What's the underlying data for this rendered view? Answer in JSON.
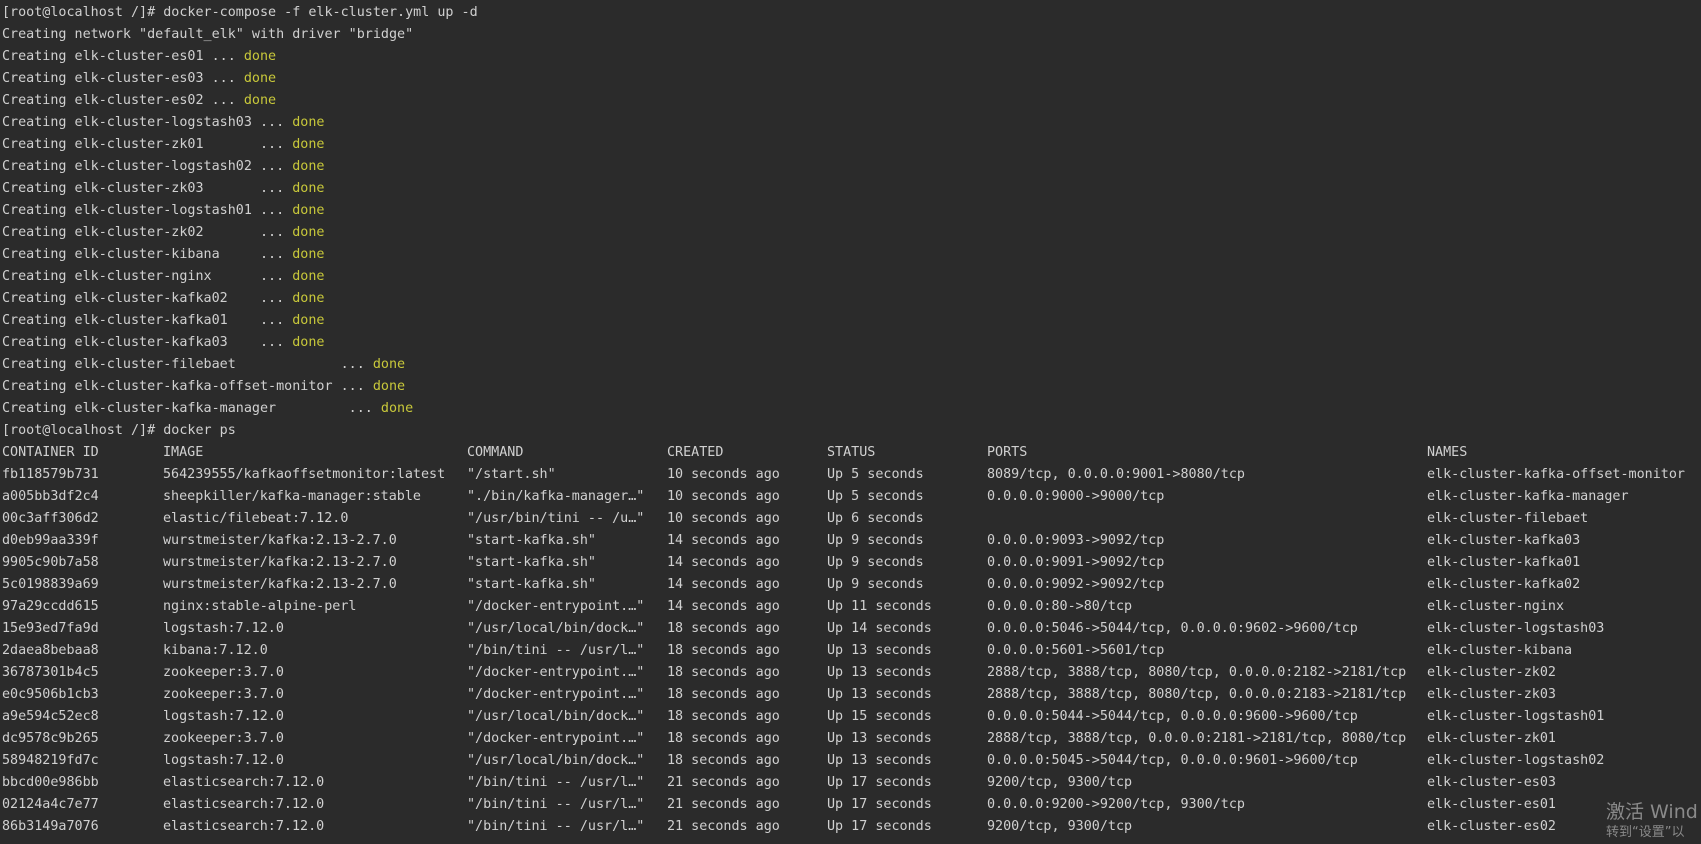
{
  "prompt": "[root@localhost /]#",
  "commands": {
    "compose": "docker-compose -f elk-cluster.yml up -d",
    "ps": "docker ps"
  },
  "network_line": "Creating network \"default_elk\" with driver \"bridge\"",
  "done_text": "done",
  "creating": [
    "Creating elk-cluster-es01 ...",
    "Creating elk-cluster-es03 ...",
    "Creating elk-cluster-es02 ...",
    "Creating elk-cluster-logstash03 ...",
    "Creating elk-cluster-zk01       ...",
    "Creating elk-cluster-logstash02 ...",
    "Creating elk-cluster-zk03       ...",
    "Creating elk-cluster-logstash01 ...",
    "Creating elk-cluster-zk02       ...",
    "Creating elk-cluster-kibana     ...",
    "Creating elk-cluster-nginx      ...",
    "Creating elk-cluster-kafka02    ...",
    "Creating elk-cluster-kafka01    ...",
    "Creating elk-cluster-kafka03    ...",
    "Creating elk-cluster-filebaet             ...",
    "Creating elk-cluster-kafka-offset-monitor ...",
    "Creating elk-cluster-kafka-manager         ..."
  ],
  "table": {
    "headers": {
      "id": "CONTAINER ID",
      "image": "IMAGE",
      "command": "COMMAND",
      "created": "CREATED",
      "status": "STATUS",
      "ports": "PORTS",
      "names": "NAMES"
    },
    "rows": [
      {
        "id": "fb118579b731",
        "image": "564239555/kafkaoffsetmonitor:latest",
        "command": "\"/start.sh\"",
        "created": "10 seconds ago",
        "status": "Up 5 seconds",
        "ports": "8089/tcp, 0.0.0.0:9001->8080/tcp",
        "names": "elk-cluster-kafka-offset-monitor"
      },
      {
        "id": "a005bb3df2c4",
        "image": "sheepkiller/kafka-manager:stable",
        "command": "\"./bin/kafka-manager…\"",
        "created": "10 seconds ago",
        "status": "Up 5 seconds",
        "ports": "0.0.0.0:9000->9000/tcp",
        "names": "elk-cluster-kafka-manager"
      },
      {
        "id": "00c3aff306d2",
        "image": "elastic/filebeat:7.12.0",
        "command": "\"/usr/bin/tini -- /u…\"",
        "created": "10 seconds ago",
        "status": "Up 6 seconds",
        "ports": "",
        "names": "elk-cluster-filebaet"
      },
      {
        "id": "d0eb99aa339f",
        "image": "wurstmeister/kafka:2.13-2.7.0",
        "command": "\"start-kafka.sh\"",
        "created": "14 seconds ago",
        "status": "Up 9 seconds",
        "ports": "0.0.0.0:9093->9092/tcp",
        "names": "elk-cluster-kafka03"
      },
      {
        "id": "9905c90b7a58",
        "image": "wurstmeister/kafka:2.13-2.7.0",
        "command": "\"start-kafka.sh\"",
        "created": "14 seconds ago",
        "status": "Up 9 seconds",
        "ports": "0.0.0.0:9091->9092/tcp",
        "names": "elk-cluster-kafka01"
      },
      {
        "id": "5c0198839a69",
        "image": "wurstmeister/kafka:2.13-2.7.0",
        "command": "\"start-kafka.sh\"",
        "created": "14 seconds ago",
        "status": "Up 9 seconds",
        "ports": "0.0.0.0:9092->9092/tcp",
        "names": "elk-cluster-kafka02"
      },
      {
        "id": "97a29ccdd615",
        "image": "nginx:stable-alpine-perl",
        "command": "\"/docker-entrypoint.…\"",
        "created": "14 seconds ago",
        "status": "Up 11 seconds",
        "ports": "0.0.0.0:80->80/tcp",
        "names": "elk-cluster-nginx"
      },
      {
        "id": "15e93ed7fa9d",
        "image": "logstash:7.12.0",
        "command": "\"/usr/local/bin/dock…\"",
        "created": "18 seconds ago",
        "status": "Up 14 seconds",
        "ports": "0.0.0.0:5046->5044/tcp, 0.0.0.0:9602->9600/tcp",
        "names": "elk-cluster-logstash03"
      },
      {
        "id": "2daea8bebaa8",
        "image": "kibana:7.12.0",
        "command": "\"/bin/tini -- /usr/l…\"",
        "created": "18 seconds ago",
        "status": "Up 13 seconds",
        "ports": "0.0.0.0:5601->5601/tcp",
        "names": "elk-cluster-kibana"
      },
      {
        "id": "36787301b4c5",
        "image": "zookeeper:3.7.0",
        "command": "\"/docker-entrypoint.…\"",
        "created": "18 seconds ago",
        "status": "Up 13 seconds",
        "ports": "2888/tcp, 3888/tcp, 8080/tcp, 0.0.0.0:2182->2181/tcp",
        "names": "elk-cluster-zk02"
      },
      {
        "id": "e0c9506b1cb3",
        "image": "zookeeper:3.7.0",
        "command": "\"/docker-entrypoint.…\"",
        "created": "18 seconds ago",
        "status": "Up 13 seconds",
        "ports": "2888/tcp, 3888/tcp, 8080/tcp, 0.0.0.0:2183->2181/tcp",
        "names": "elk-cluster-zk03"
      },
      {
        "id": "a9e594c52ec8",
        "image": "logstash:7.12.0",
        "command": "\"/usr/local/bin/dock…\"",
        "created": "18 seconds ago",
        "status": "Up 15 seconds",
        "ports": "0.0.0.0:5044->5044/tcp, 0.0.0.0:9600->9600/tcp",
        "names": "elk-cluster-logstash01"
      },
      {
        "id": "dc9578c9b265",
        "image": "zookeeper:3.7.0",
        "command": "\"/docker-entrypoint.…\"",
        "created": "18 seconds ago",
        "status": "Up 13 seconds",
        "ports": "2888/tcp, 3888/tcp, 0.0.0.0:2181->2181/tcp, 8080/tcp",
        "names": "elk-cluster-zk01"
      },
      {
        "id": "58948219fd7c",
        "image": "logstash:7.12.0",
        "command": "\"/usr/local/bin/dock…\"",
        "created": "18 seconds ago",
        "status": "Up 13 seconds",
        "ports": "0.0.0.0:5045->5044/tcp, 0.0.0.0:9601->9600/tcp",
        "names": "elk-cluster-logstash02"
      },
      {
        "id": "bbcd00e986bb",
        "image": "elasticsearch:7.12.0",
        "command": "\"/bin/tini -- /usr/l…\"",
        "created": "21 seconds ago",
        "status": "Up 17 seconds",
        "ports": "9200/tcp, 9300/tcp",
        "names": "elk-cluster-es03"
      },
      {
        "id": "02124a4c7e77",
        "image": "elasticsearch:7.12.0",
        "command": "\"/bin/tini -- /usr/l…\"",
        "created": "21 seconds ago",
        "status": "Up 17 seconds",
        "ports": "0.0.0.0:9200->9200/tcp, 9300/tcp",
        "names": "elk-cluster-es01"
      },
      {
        "id": "86b3149a7076",
        "image": "elasticsearch:7.12.0",
        "command": "\"/bin/tini -- /usr/l…\"",
        "created": "21 seconds ago",
        "status": "Up 17 seconds",
        "ports": "9200/tcp, 9300/tcp",
        "names": "elk-cluster-es02"
      }
    ]
  },
  "watermark": {
    "line1": "激活 Wind",
    "line2": "转到“设置”以"
  },
  "colors": {
    "background": "#2b2b2b",
    "text": "#d0d0d0",
    "done": "#c8c83a"
  }
}
